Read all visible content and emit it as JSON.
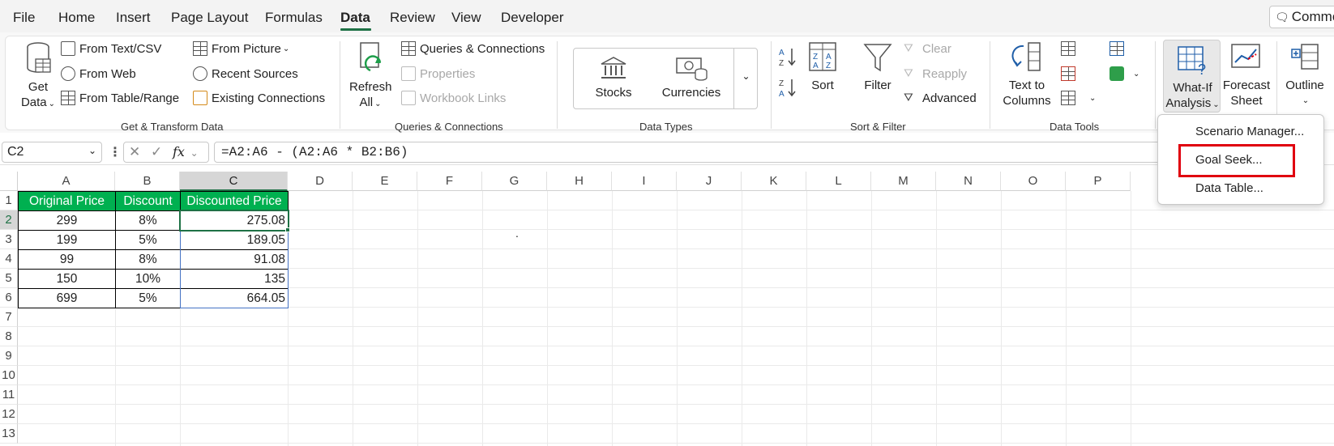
{
  "menubar": {
    "tabs": [
      {
        "label": "File"
      },
      {
        "label": "Home"
      },
      {
        "label": "Insert"
      },
      {
        "label": "Page Layout"
      },
      {
        "label": "Formulas"
      },
      {
        "label": "Data"
      },
      {
        "label": "Review"
      },
      {
        "label": "View"
      },
      {
        "label": "Developer"
      }
    ],
    "active_tab": "Data",
    "comments_label": "Comme"
  },
  "ribbon": {
    "get_transform": {
      "title": "Get & Transform Data",
      "get_data_line1": "Get",
      "get_data_line2": "Data",
      "from_text_csv": "From Text/CSV",
      "from_web": "From Web",
      "from_table_range": "From Table/Range",
      "from_picture": "From Picture",
      "recent_sources": "Recent Sources",
      "existing_connections": "Existing Connections"
    },
    "queries": {
      "title": "Queries & Connections",
      "refresh_line1": "Refresh",
      "refresh_line2": "All",
      "queries_connections": "Queries & Connections",
      "properties": "Properties",
      "workbook_links": "Workbook Links"
    },
    "data_types": {
      "title": "Data Types",
      "stocks": "Stocks",
      "currencies": "Currencies"
    },
    "sort_filter": {
      "title": "Sort & Filter",
      "sort": "Sort",
      "filter": "Filter",
      "clear": "Clear",
      "reapply": "Reapply",
      "advanced": "Advanced"
    },
    "data_tools": {
      "title": "Data Tools",
      "text_to_columns_line1": "Text to",
      "text_to_columns_line2": "Columns"
    },
    "forecast": {
      "whatif_line1": "What-If",
      "whatif_line2": "Analysis",
      "forecast_line1": "Forecast",
      "forecast_line2": "Sheet",
      "outline": "Outline"
    }
  },
  "formula_bar": {
    "name_box": "C2",
    "fx": "fx",
    "formula": "=A2:A6 - (A2:A6 * B2:B6)"
  },
  "sheet": {
    "columns": [
      "A",
      "B",
      "C",
      "D",
      "E",
      "F",
      "G",
      "H",
      "I",
      "J",
      "K",
      "L",
      "M",
      "N",
      "O",
      "P"
    ],
    "rows": [
      "1",
      "2",
      "3",
      "4",
      "5",
      "6",
      "7",
      "8",
      "9",
      "10",
      "11",
      "12",
      "13"
    ],
    "headers": [
      "Original Price",
      "Discount",
      "Discounted Price"
    ],
    "data": [
      [
        "299",
        "8%",
        "275.08"
      ],
      [
        "199",
        "5%",
        "189.05"
      ],
      [
        "99",
        "8%",
        "91.08"
      ],
      [
        "150",
        "10%",
        "135"
      ],
      [
        "699",
        "5%",
        "664.05"
      ]
    ],
    "stray_mark": "."
  },
  "whatif_menu": {
    "items": [
      {
        "label": "Scenario Manager..."
      },
      {
        "label": "Goal Seek..."
      },
      {
        "label": "Data Table..."
      }
    ]
  },
  "colors": {
    "accent": "#1e7145",
    "header_fill": "#00b050",
    "highlight": "#e0000f"
  }
}
